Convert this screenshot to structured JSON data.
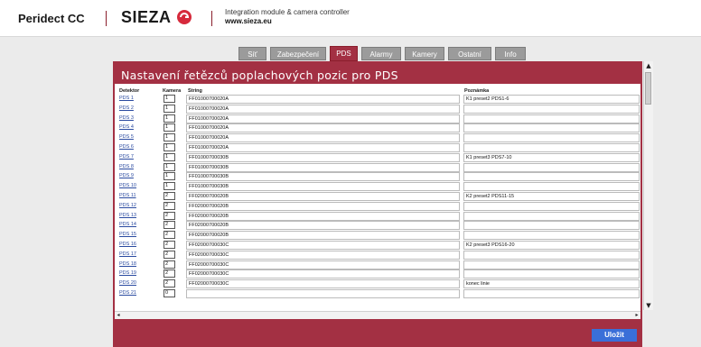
{
  "header": {
    "brand": "Peridect CC",
    "logo": "SIEZA",
    "logo_icon": "sieza-mark-icon",
    "tagline": "Integration module & camera controller",
    "website": "www.sieza.eu"
  },
  "tabs": [
    {
      "label": "Síť",
      "active": false
    },
    {
      "label": "Zabezpečení",
      "active": false
    },
    {
      "label": "PDS",
      "active": true
    },
    {
      "label": "Alarmy",
      "active": false
    },
    {
      "label": "Kamery",
      "active": false
    },
    {
      "label": "Ostatní",
      "active": false
    },
    {
      "label": "Info",
      "active": false
    }
  ],
  "panel": {
    "title": "Nastavení řetězců poplachových pozic pro PDS",
    "columns": {
      "detector": "Detektor",
      "camera": "Kamera",
      "string": "String",
      "note": "Poznámka"
    },
    "rows": [
      {
        "detector": "PDS 1",
        "camera": "1",
        "string": "FF01000700020A",
        "note": "K1 preset2 PDS1-6"
      },
      {
        "detector": "PDS 2",
        "camera": "1",
        "string": "FF01000700020A",
        "note": ""
      },
      {
        "detector": "PDS 3",
        "camera": "1",
        "string": "FF01000700020A",
        "note": ""
      },
      {
        "detector": "PDS 4",
        "camera": "1",
        "string": "FF01000700020A",
        "note": ""
      },
      {
        "detector": "PDS 5",
        "camera": "1",
        "string": "FF01000700020A",
        "note": ""
      },
      {
        "detector": "PDS 6",
        "camera": "1",
        "string": "FF01000700020A",
        "note": ""
      },
      {
        "detector": "PDS 7",
        "camera": "1",
        "string": "FF01000700030B",
        "note": "K1 preset3 PDS7-10"
      },
      {
        "detector": "PDS 8",
        "camera": "1",
        "string": "FF01000700030B",
        "note": ""
      },
      {
        "detector": "PDS 9",
        "camera": "1",
        "string": "FF01000700030B",
        "note": ""
      },
      {
        "detector": "PDS 10",
        "camera": "1",
        "string": "FF01000700030B",
        "note": ""
      },
      {
        "detector": "PDS 11",
        "camera": "2",
        "string": "FF02000700020B",
        "note": "K2 preset2 PDS11-15"
      },
      {
        "detector": "PDS 12",
        "camera": "2",
        "string": "FF02000700020B",
        "note": ""
      },
      {
        "detector": "PDS 13",
        "camera": "2",
        "string": "FF02000700020B",
        "note": ""
      },
      {
        "detector": "PDS 14",
        "camera": "2",
        "string": "FF02000700020B",
        "note": ""
      },
      {
        "detector": "PDS 15",
        "camera": "2",
        "string": "FF02000700020B",
        "note": ""
      },
      {
        "detector": "PDS 16",
        "camera": "2",
        "string": "FF02000700030C",
        "note": "K2 preset3 PDS16-20"
      },
      {
        "detector": "PDS 17",
        "camera": "2",
        "string": "FF02000700030C",
        "note": ""
      },
      {
        "detector": "PDS 18",
        "camera": "2",
        "string": "FF02000700030C",
        "note": ""
      },
      {
        "detector": "PDS 19",
        "camera": "2",
        "string": "FF02000700030C",
        "note": ""
      },
      {
        "detector": "PDS 20",
        "camera": "2",
        "string": "FF02000700030C",
        "note": "konec linie"
      },
      {
        "detector": "PDS 21",
        "camera": "0",
        "string": "",
        "note": ""
      }
    ]
  },
  "save_label": "Uložit",
  "colors": {
    "accent": "#a33043",
    "tab_inactive": "#9b9b9b",
    "save_button": "#3a6fd8",
    "link": "#2a4aa0"
  }
}
